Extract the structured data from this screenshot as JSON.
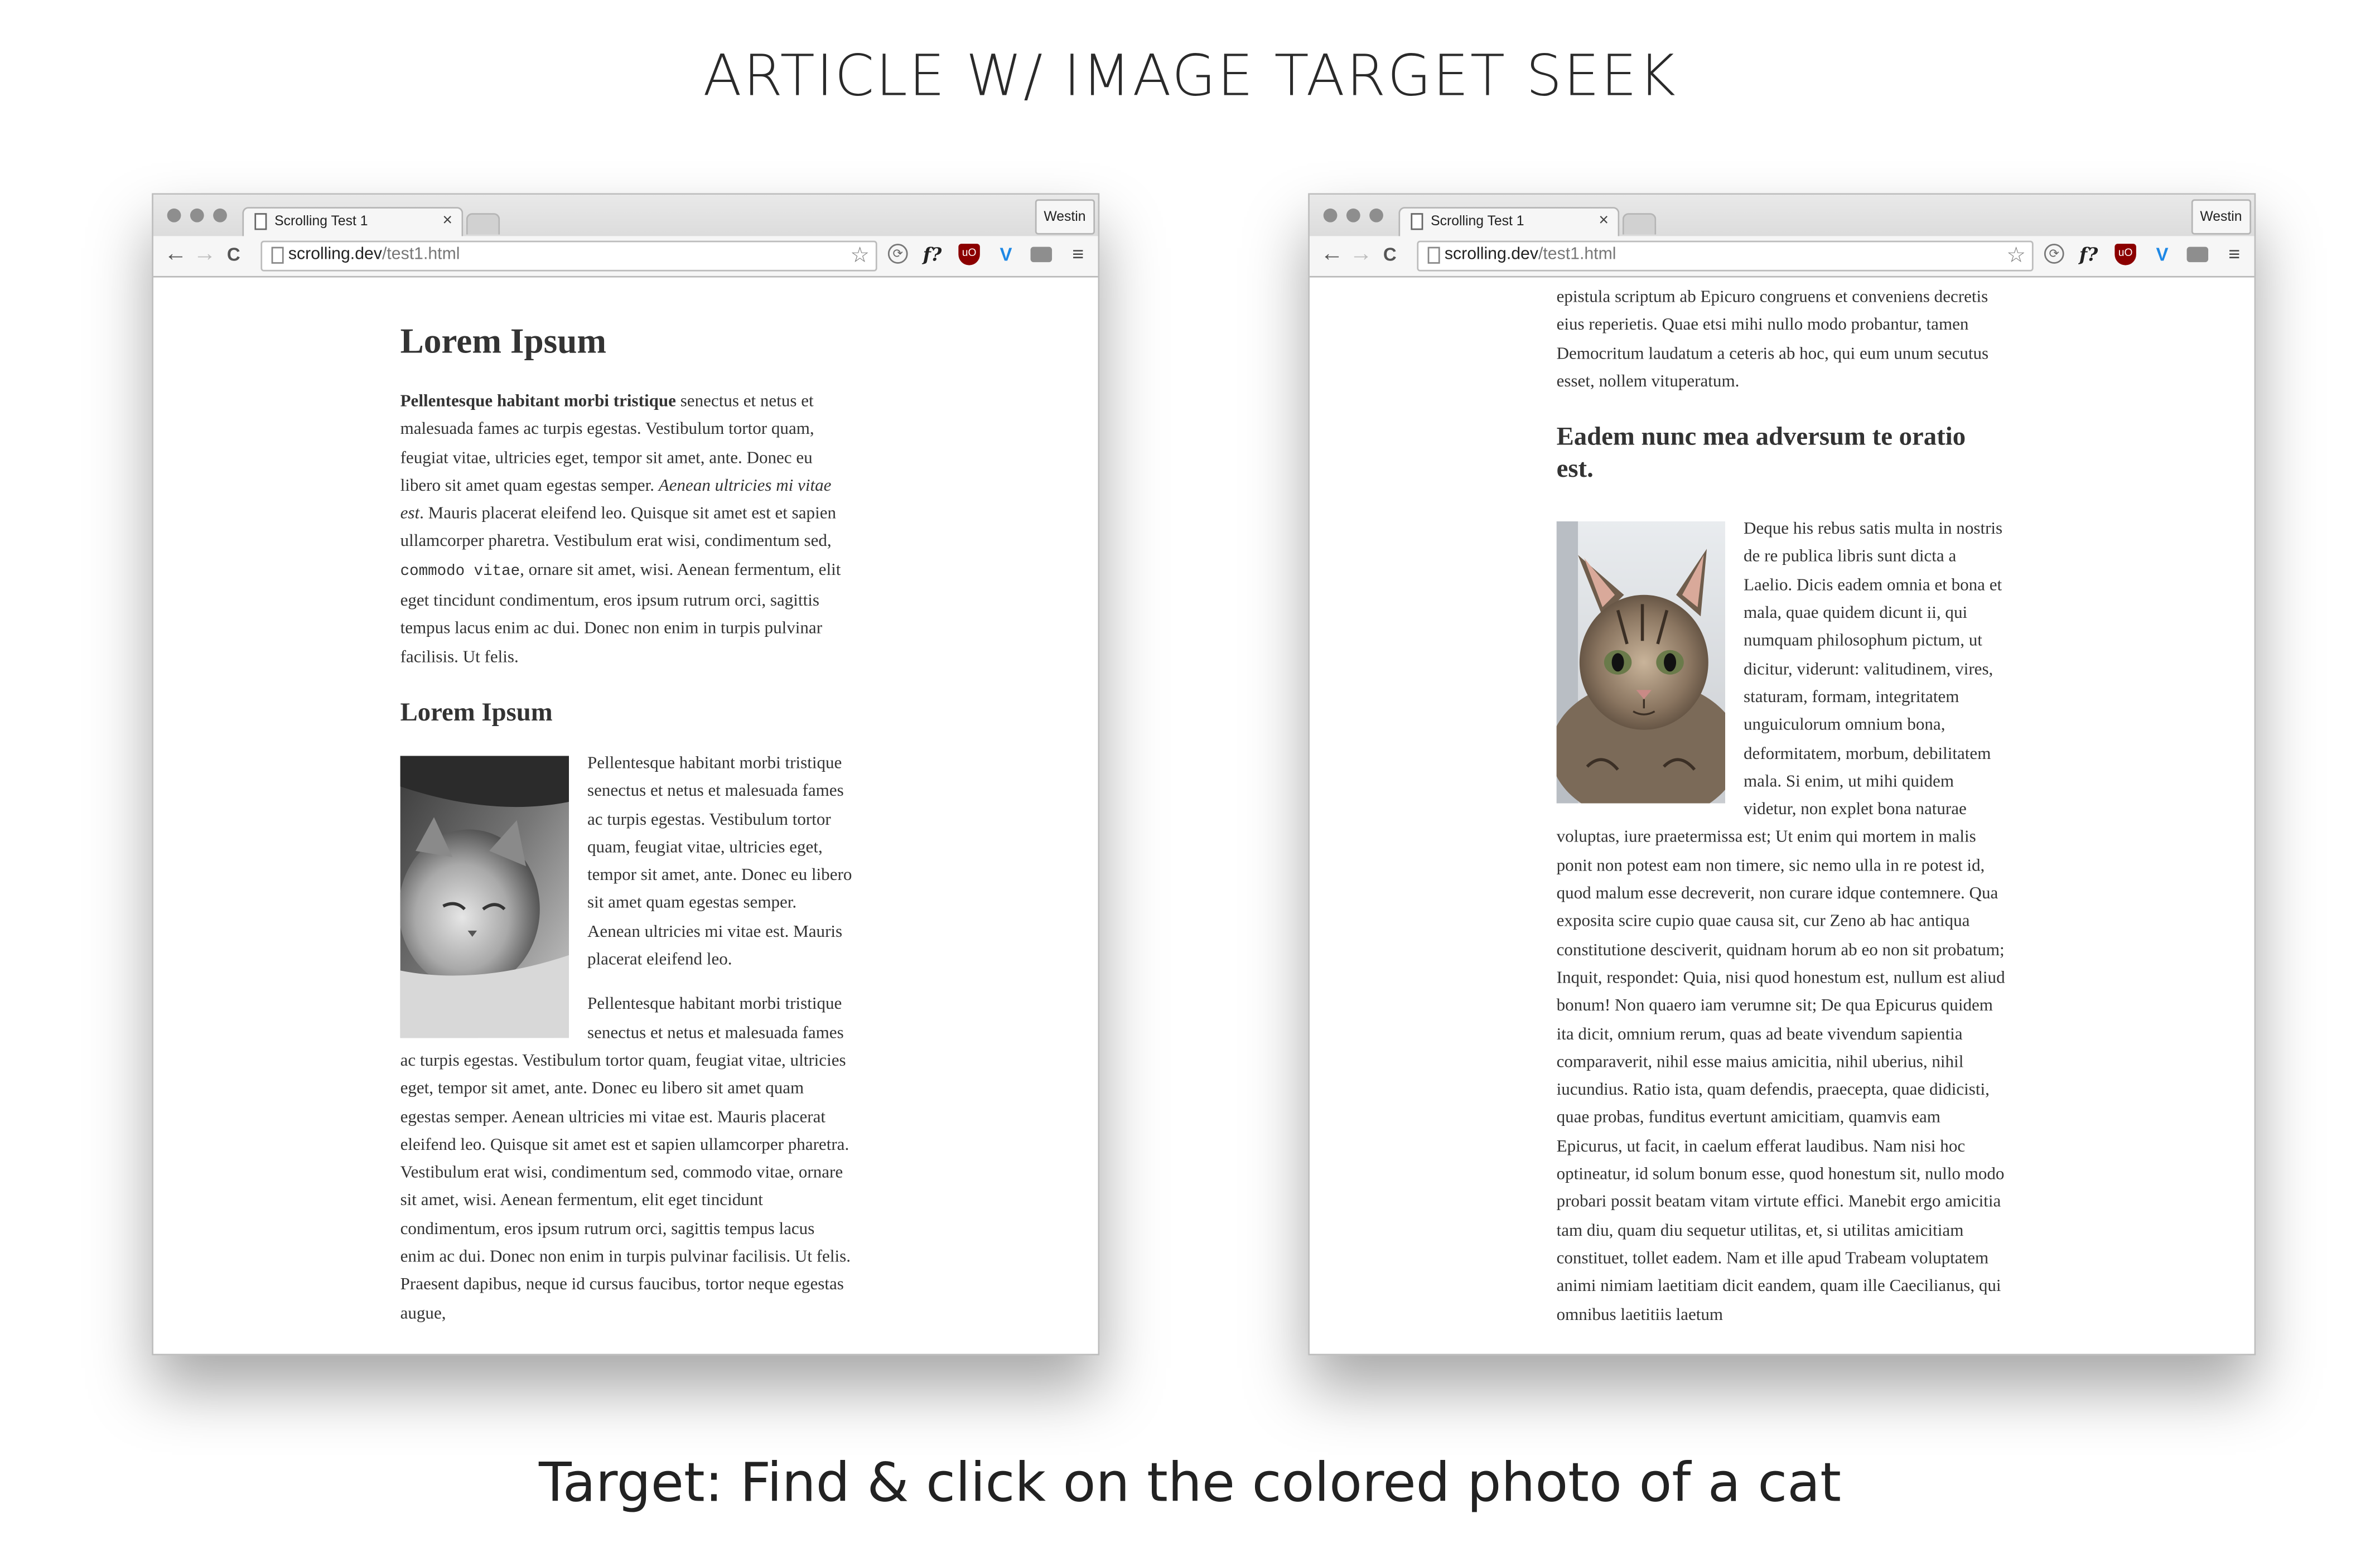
{
  "heading": "ARTICLE W/ IMAGE TARGET SEEK",
  "caption": "Target: Find & click on the colored photo of a cat",
  "browser": {
    "tab_title": "Scrolling Test 1",
    "tab_close": "×",
    "profile_name": "Westin",
    "url_host": "scrolling.dev",
    "url_path": "/test1.html",
    "star_glyph": "☆",
    "menu_glyph": "≡",
    "nav": {
      "back": "←",
      "forward": "→",
      "reload": "C"
    },
    "extensions": {
      "f_glyph": "f?",
      "ublock_glyph": "uO",
      "v_glyph": "V"
    }
  },
  "left": {
    "h1": "Lorem Ipsum",
    "p1_bold": "Pellentesque habitant morbi tristique",
    "p1_a": " senectus et netus et malesuada fames ac turpis egestas. Vestibulum tortor quam, feugiat vitae, ultricies eget, tempor sit amet, ante. Donec eu libero sit amet quam egestas semper. ",
    "p1_italic": "Aenean ultricies mi vitae est",
    "p1_b": ". Mauris placerat eleifend leo. Quisque sit amet est et sapien ullamcorper pharetra. Vestibulum erat wisi, condimentum sed, ",
    "p1_code": "commodo vitae",
    "p1_c": ", ornare sit amet, wisi. Aenean fermentum, elit eget tincidunt condimentum, eros ipsum rutrum orci, sagittis tempus lacus enim ac dui. Donec non enim in turpis pulvinar facilisis. Ut felis.",
    "h2": "Lorem Ipsum",
    "p2": "Pellentesque habitant morbi tristique senectus et netus et malesuada fames ac turpis egestas. Vestibulum tortor quam, feugiat vitae, ultricies eget, tempor sit amet, ante. Donec eu libero sit amet quam egestas semper. Aenean ultricies mi vitae est. Mauris placerat eleifend leo.",
    "p3": "Pellentesque habitant morbi tristique senectus et netus et malesuada fames ac turpis egestas. Vestibulum tortor quam, feugiat vitae, ultricies eget, tempor sit amet, ante. Donec eu libero sit amet quam egestas semper. Aenean ultricies mi vitae est. Mauris placerat eleifend leo. Quisque sit amet est et sapien ullamcorper pharetra. Vestibulum erat wisi, condimentum sed, commodo vitae, ornare sit amet, wisi. Aenean fermentum, elit eget tincidunt condimentum, eros ipsum rutrum orci, sagittis tempus lacus enim ac dui. Donec non enim in turpis pulvinar facilisis. Ut felis. Praesent dapibus, neque id cursus faucibus, tortor neque egestas augue,"
  },
  "right": {
    "p_top": "epistula scriptum ab Epicuro congruens et conveniens decretis eius reperietis. Quae etsi mihi nullo modo probantur, tamen Democritum laudatum a ceteris ab hoc, qui eum unum secutus esset, nollem vituperatum.",
    "h2": "Eadem nunc mea adversum te oratio est.",
    "p_body": "Deque his rebus satis multa in nostris de re publica libris sunt dicta a Laelio. Dicis eadem omnia et bona et mala, quae quidem dicunt ii, qui numquam philosophum pictum, ut dicitur, viderunt: valitudinem, vires, staturam, formam, integritatem unguiculorum omnium bona, deformitatem, morbum, debilitatem mala. Si enim, ut mihi quidem videtur, non explet bona naturae voluptas, iure praetermissa est; Ut enim qui mortem in malis ponit non potest eam non timere, sic nemo ulla in re potest id, quod malum esse decreverit, non curare idque contemnere. Qua exposita scire cupio quae causa sit, cur Zeno ab hac antiqua constitutione desciverit, quidnam horum ab eo non sit probatum; Inquit, respondet: Quia, nisi quod honestum est, nullum est aliud bonum! Non quaero iam verumne sit; De qua Epicurus quidem ita dicit, omnium rerum, quas ad beate vivendum sapientia comparaverit, nihil esse maius amicitia, nihil uberius, nihil iucundius. Ratio ista, quam defendis, praecepta, quae didicisti, quae probas, funditus evertunt amicitiam, quamvis eam Epicurus, ut facit, in caelum efferat laudibus. Nam nisi hoc optineatur, id solum bonum esse, quod honestum sit, nullo modo probari possit beatam vitam virtute effici. Manebit ergo amicitia tam diu, quam diu sequetur utilitas, et, si utilitas amicitiam constituet, tollet eadem. Nam et ille apud Trabeam voluptatem animi nimiam laetitiam dicit eandem, quam ille Caecilianus, qui omnibus laetitiis laetum"
  }
}
